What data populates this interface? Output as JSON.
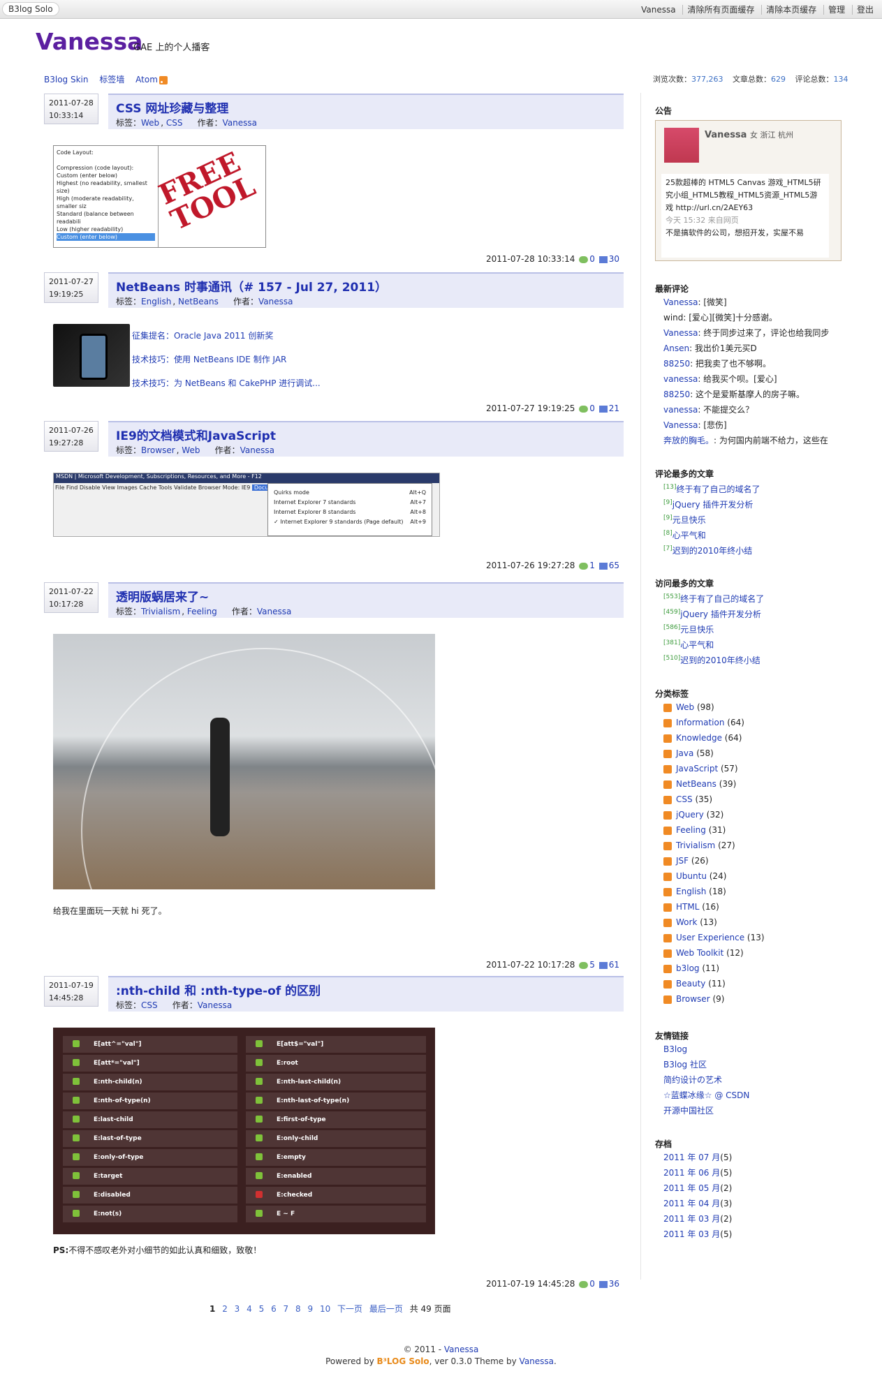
{
  "topbar": {
    "brand": "B3log Solo",
    "links": [
      "Vanessa",
      "清除所有页面缓存",
      "清除本页缓存",
      "管理",
      "登出"
    ]
  },
  "header": {
    "title": "Vanessa",
    "subtitle": "GAE 上的个人播客"
  },
  "nav": {
    "skin": "B3log Skin",
    "tags": "标签墙",
    "atom": "Atom"
  },
  "stats": {
    "views_label": "浏览次数：",
    "views": "377,263",
    "articles_label": "文章总数：",
    "articles": "629",
    "comments_label": "评论总数：",
    "comments": "134"
  },
  "labels": {
    "tags": "标签：",
    "author": "作者：",
    "author_name": "Vanessa"
  },
  "posts": [
    {
      "date": "2011-07-28",
      "time": "10:33:14",
      "title": "CSS 网址珍藏与整理",
      "tags": [
        "Web",
        "CSS"
      ],
      "footer_time": "2011-07-28 10:33:14",
      "comments": "0",
      "views": "30"
    },
    {
      "date": "2011-07-27",
      "time": "19:19:25",
      "title": "NetBeans 时事通讯（# 157 - Jul 27, 2011）",
      "tags": [
        "English",
        "NetBeans"
      ],
      "footer_time": "2011-07-27 19:19:25",
      "comments": "0",
      "views": "21",
      "links": [
        "征集提名：Oracle Java 2011 创新奖",
        "技术技巧：使用 NetBeans IDE 制作 JAR",
        "技术技巧：为 NetBeans 和 CakePHP 进行调试..."
      ]
    },
    {
      "date": "2011-07-26",
      "time": "19:27:28",
      "title": "IE9的文档模式和JavaScript",
      "tags": [
        "Browser",
        "Web"
      ],
      "footer_time": "2011-07-26 19:27:28",
      "comments": "1",
      "views": "65"
    },
    {
      "date": "2011-07-22",
      "time": "10:17:28",
      "title": "透明版蜗居来了~",
      "tags": [
        "Trivialism",
        "Feeling"
      ],
      "footer_time": "2011-07-22 10:17:28",
      "comments": "5",
      "views": "61",
      "text": "给我在里面玩一天就 hi 死了。"
    },
    {
      "date": "2011-07-19",
      "time": "14:45:28",
      "title": ":nth-child 和 :nth-type-of 的区别",
      "tags": [
        "CSS"
      ],
      "footer_time": "2011-07-19 14:45:28",
      "comments": "0",
      "views": "36",
      "ps_label": "PS:",
      "ps": "不得不感叹老外对小细节的如此认真和细致，致敬！"
    }
  ],
  "img1": {
    "lines": [
      "Code Layout:",
      "",
      "Compression (code layout):",
      "Custom (enter below)",
      "Highest (no readability, smallest size)",
      "High (moderate readability, smaller siz",
      "Standard (balance between readabili",
      "Low (higher readability)",
      "Custom (enter below)"
    ],
    "stamp": "FREE TOOL"
  },
  "img3": {
    "titlebar": "MSDN | Microsoft Development, Subscriptions, Resources, and More - F12",
    "menubar": "File  Find  Disable  View  Images  Cache  Tools  Validate  Browser Mode: IE9",
    "mode": "Document Mode: IE9 standards",
    "options": [
      "Quirks mode",
      "Internet Explorer 7 standards",
      "Internet Explorer 8 standards",
      "✓  Internet Explorer 9 standards (Page default)"
    ],
    "shortcuts": [
      "Alt+Q",
      "Alt+7",
      "Alt+8",
      "Alt+9"
    ]
  },
  "img5": {
    "left": [
      "E[att^=\"val\"]",
      "E[att*=\"val\"]",
      "E:nth-child(n)",
      "E:nth-of-type(n)",
      "E:last-child",
      "E:last-of-type",
      "E:only-of-type",
      "E:target",
      "E:disabled",
      "E:not(s)"
    ],
    "right": [
      "E[att$=\"val\"]",
      "E:root",
      "E:nth-last-child(n)",
      "E:nth-last-of-type(n)",
      "E:first-of-type",
      "E:only-child",
      "E:empty",
      "E:enabled",
      "E:checked",
      "E ~ F"
    ]
  },
  "pager": {
    "current": "1",
    "pages": [
      "2",
      "3",
      "4",
      "5",
      "6",
      "7",
      "8",
      "9",
      "10"
    ],
    "next": "下一页",
    "last": "最后一页",
    "total": "共 49 页面"
  },
  "sidebar": {
    "notice_title": "公告",
    "notice_name": "Vanessa",
    "notice_info": "女 浙江 杭州",
    "notice_text": "25款超棒的 HTML5 Canvas 游戏_HTML5研究小组_HTML5教程_HTML5资源_HTML5游戏 http://url.cn/2AEY63",
    "notice_time": "今天 15:32 来自网页",
    "notice_more": "不是搞软件的公司，想招开发，实屋不易",
    "recent_title": "最新评论",
    "recent": [
      {
        "name": "Vanessa",
        "text": ": [微笑]"
      },
      {
        "name": "wind",
        "text": ": [爱心][微笑]十分感谢。"
      },
      {
        "name": "Vanessa",
        "text": ": 终于同步过来了，评论也给我同步"
      },
      {
        "name": "Ansen",
        "text": ": 我出价1美元买D"
      },
      {
        "name": "88250",
        "text": ": 把我卖了也不够啊。"
      },
      {
        "name": "vanessa",
        "text": ": 给我买个呗。[爱心]"
      },
      {
        "name": "88250",
        "text": ": 这个是爱斯基摩人的房子嘛。"
      },
      {
        "name": "vanessa",
        "text": ": 不能提交么？"
      },
      {
        "name": "Vanessa",
        "text": ": [悲伤]"
      },
      {
        "name": "奔放的胸毛。",
        "text": ": 为何国内前端不给力，这些在"
      }
    ],
    "mostcomment_title": "评论最多的文章",
    "mostcomment": [
      {
        "n": "[13]",
        "t": "终于有了自己的域名了"
      },
      {
        "n": "[9]",
        "t": "jQuery 插件开发分析"
      },
      {
        "n": "[9]",
        "t": "元旦快乐"
      },
      {
        "n": "[8]",
        "t": "心平气和"
      },
      {
        "n": "[7]",
        "t": "迟到的2010年终小结"
      }
    ],
    "mostview_title": "访问最多的文章",
    "mostview": [
      {
        "n": "[553]",
        "t": "终于有了自己的域名了"
      },
      {
        "n": "[459]",
        "t": "jQuery 插件开发分析"
      },
      {
        "n": "[586]",
        "t": "元旦快乐"
      },
      {
        "n": "[381]",
        "t": "心平气和"
      },
      {
        "n": "[510]",
        "t": "迟到的2010年终小结"
      }
    ],
    "tags_title": "分类标签",
    "tags": [
      {
        "t": "Web",
        "c": "(98)"
      },
      {
        "t": "Information",
        "c": "(64)"
      },
      {
        "t": "Knowledge",
        "c": "(64)"
      },
      {
        "t": "Java",
        "c": "(58)"
      },
      {
        "t": "JavaScript",
        "c": "(57)"
      },
      {
        "t": "NetBeans",
        "c": "(39)"
      },
      {
        "t": "CSS",
        "c": "(35)"
      },
      {
        "t": "jQuery",
        "c": "(32)"
      },
      {
        "t": "Feeling",
        "c": "(31)"
      },
      {
        "t": "Trivialism",
        "c": "(27)"
      },
      {
        "t": "JSF",
        "c": "(26)"
      },
      {
        "t": "Ubuntu",
        "c": "(24)"
      },
      {
        "t": "English",
        "c": "(18)"
      },
      {
        "t": "HTML",
        "c": "(16)"
      },
      {
        "t": "Work",
        "c": "(13)"
      },
      {
        "t": "User Experience",
        "c": "(13)"
      },
      {
        "t": "Web Toolkit",
        "c": "(12)"
      },
      {
        "t": "b3log",
        "c": "(11)"
      },
      {
        "t": "Beauty",
        "c": "(11)"
      },
      {
        "t": "Browser",
        "c": "(9)"
      }
    ],
    "links_title": "友情链接",
    "links": [
      "B3log",
      "B3log 社区",
      "简约设计の艺术",
      "☆蓝蝶冰缘☆ @ CSDN",
      "开源中国社区"
    ],
    "archive_title": "存档",
    "archive": [
      {
        "t": "2011 年 07 月",
        "c": "(5)"
      },
      {
        "t": "2011 年 06 月",
        "c": "(5)"
      },
      {
        "t": "2011 年 05 月",
        "c": "(2)"
      },
      {
        "t": "2011 年 04 月",
        "c": "(3)"
      },
      {
        "t": "2011 年 03 月",
        "c": "(2)"
      },
      {
        "t": "2011 年 03 月",
        "c": "(5)"
      }
    ]
  },
  "footer": {
    "copy": "© 2011 - ",
    "owner": "Vanessa",
    "powered": "Powered by ",
    "b3log": "B³LOG Solo",
    "ver": ", ver 0.3.0   Theme by ",
    "theme_author": "Vanessa",
    "dot": "."
  }
}
